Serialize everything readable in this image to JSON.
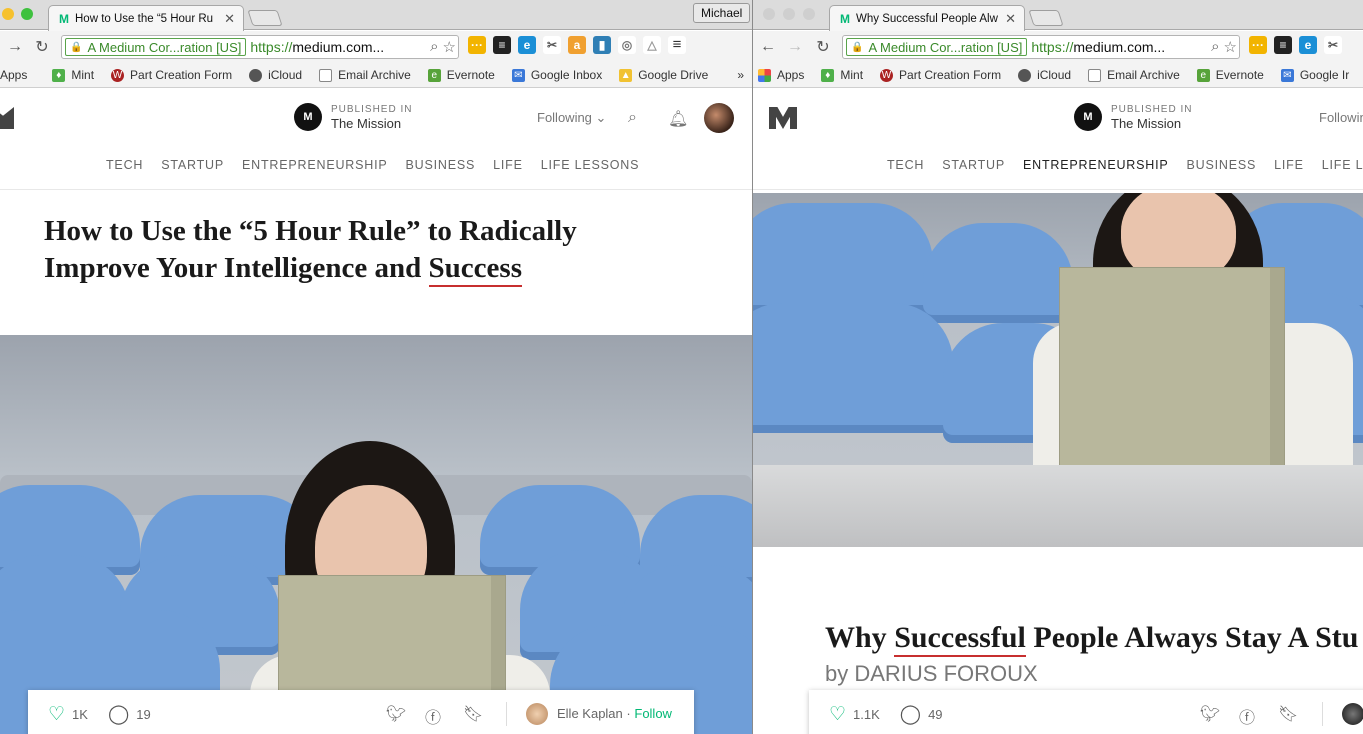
{
  "left": {
    "tab_title": "How to Use the “5 Hour Ru",
    "profile_label": "Michael",
    "ev_label": "A Medium Cor...ration [US]",
    "url_scheme": "https://",
    "url_rest": "medium.com...",
    "bookmarks": [
      "Apps",
      "Mint",
      "Part Creation Form",
      "iCloud",
      "Email Archive",
      "Evernote",
      "Google Inbox",
      "Google Drive"
    ],
    "bookmarks_more": "»",
    "pub_kicker": "PUBLISHED IN",
    "pub_name": "The Mission",
    "following_label": "Following",
    "nav": [
      "TECH",
      "STARTUP",
      "ENTREPRENEURSHIP",
      "BUSINESS",
      "LIFE",
      "LIFE LESSONS"
    ],
    "headline_line1": "How to Use the “5 Hour Rule” to Radically",
    "headline_line2_start": "Improve Your Intelligence and ",
    "headline_line2_end": "Success",
    "claps": "1K",
    "responses": "19",
    "author": "Elle Kaplan",
    "author_sep": "·",
    "follow_label": "Follow"
  },
  "right": {
    "tab_title": "Why Successful People Alw",
    "ev_label": "A Medium Cor...ration [US]",
    "url_scheme": "https://",
    "url_rest": "medium.com...",
    "bookmarks": [
      "Apps",
      "Mint",
      "Part Creation Form",
      "iCloud",
      "Email Archive",
      "Evernote",
      "Google Ir"
    ],
    "pub_kicker": "PUBLISHED IN",
    "pub_name": "The Mission",
    "following_label": "Followin",
    "nav": [
      "TECH",
      "STARTUP",
      "ENTREPRENEURSHIP",
      "BUSINESS",
      "LIFE",
      "LIFE LESS"
    ],
    "nav_active_index": 2,
    "headline_start": "Why ",
    "headline_squiggle": "Successful",
    "headline_end": " People Always Stay A Stu",
    "byline": "by DARIUS FOROUX",
    "claps": "1.1K",
    "responses": "49"
  },
  "colors": {
    "medium_green": "#02b875",
    "ev_green": "#3a8a2a",
    "spellcheck_red": "#c72f2f",
    "seat_blue": "#6f9ed8"
  }
}
